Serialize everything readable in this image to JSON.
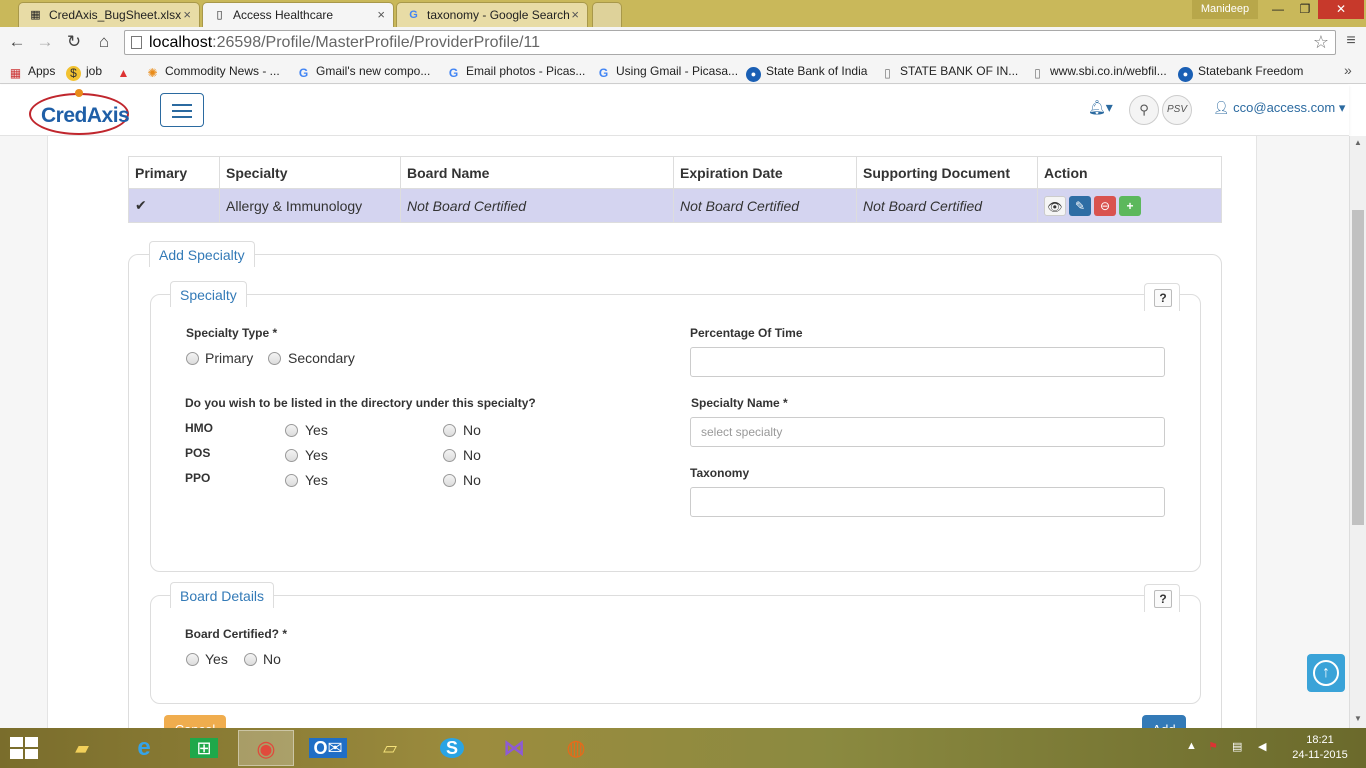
{
  "browser": {
    "tabs": [
      {
        "title": "CredAxis_BugSheet.xlsx",
        "active": false
      },
      {
        "title": "Access Healthcare",
        "active": true
      },
      {
        "title": "taxonomy - Google Search",
        "active": false
      }
    ],
    "window_user": "Manideep",
    "url_host": "localhost",
    "url_path": ":26598/Profile/MasterProfile/ProviderProfile/11",
    "bookmarks": [
      {
        "label": "Apps",
        "icon": "apps-grid-icon"
      },
      {
        "label": "job",
        "icon": "job-icon"
      },
      {
        "label": "",
        "icon": "warning-triangle-icon"
      },
      {
        "label": "Commodity News - ...",
        "icon": "commodity-icon"
      },
      {
        "label": "Gmail's new compo...",
        "icon": "google-icon"
      },
      {
        "label": "Email photos - Picas...",
        "icon": "google-icon"
      },
      {
        "label": "Using Gmail - Picasa...",
        "icon": "google-icon"
      },
      {
        "label": "State Bank of India",
        "icon": "sbi-icon"
      },
      {
        "label": "STATE BANK OF IN...",
        "icon": "page-icon"
      },
      {
        "label": "www.sbi.co.in/webfil...",
        "icon": "page-icon"
      },
      {
        "label": "Statebank Freedom",
        "icon": "sbi-icon"
      }
    ]
  },
  "header": {
    "logo_text": "CredAxis",
    "psv_label": "PSV",
    "user_email": "cco@access.com"
  },
  "table": {
    "headers": [
      "Primary",
      "Specialty",
      "Board Name",
      "Expiration Date",
      "Supporting Document",
      "Action"
    ],
    "rows": [
      {
        "primary": "✔",
        "specialty": "Allergy & Immunology",
        "board_name": "Not Board Certified",
        "expiration_date": "Not Board Certified",
        "supporting_document": "Not Board Certified"
      }
    ]
  },
  "add_specialty": {
    "legend": "Add Specialty",
    "specialty_section": {
      "legend": "Specialty",
      "help": "?",
      "specialty_type_label": "Specialty Type *",
      "specialty_type_options": [
        "Primary",
        "Secondary"
      ],
      "directory_question": "Do you wish to be listed in the directory under this specialty?",
      "directory_rows": [
        {
          "label": "HMO",
          "yes": "Yes",
          "no": "No"
        },
        {
          "label": "POS",
          "yes": "Yes",
          "no": "No"
        },
        {
          "label": "PPO",
          "yes": "Yes",
          "no": "No"
        }
      ],
      "percentage_label": "Percentage Of Time",
      "percentage_value": "",
      "specialty_name_label": "Specialty Name *",
      "specialty_name_placeholder": "select specialty",
      "taxonomy_label": "Taxonomy",
      "taxonomy_value": ""
    },
    "board_section": {
      "legend": "Board Details",
      "help": "?",
      "board_certified_label": "Board Certified? *",
      "options": [
        "Yes",
        "No"
      ]
    },
    "cancel_label": "Cancel",
    "add_label": "Add"
  },
  "taskbar": {
    "time": "18:21",
    "date": "24-11-2015"
  }
}
